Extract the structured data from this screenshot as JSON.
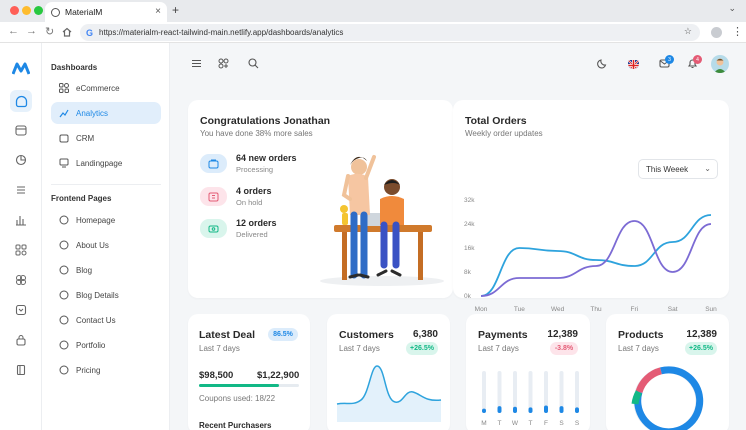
{
  "browser": {
    "tab_title": "MaterialM",
    "url": "https://materialm-react-tailwind-main.netlify.app/dashboards/analytics"
  },
  "sidebar": {
    "section_dashboards": "Dashboards",
    "dashboards": [
      {
        "label": "eCommerce",
        "icon": "grid-icon"
      },
      {
        "label": "Analytics",
        "icon": "chart-icon",
        "active": true
      },
      {
        "label": "CRM",
        "icon": "folder-icon"
      },
      {
        "label": "Landingpage",
        "icon": "screen-icon"
      }
    ],
    "section_frontend": "Frontend Pages",
    "frontend": [
      {
        "label": "Homepage",
        "icon": "circle-icon"
      },
      {
        "label": "About Us",
        "icon": "circle-icon"
      },
      {
        "label": "Blog",
        "icon": "circle-icon"
      },
      {
        "label": "Blog Details",
        "icon": "circle-icon"
      },
      {
        "label": "Contact Us",
        "icon": "circle-icon"
      },
      {
        "label": "Portfolio",
        "icon": "circle-icon"
      },
      {
        "label": "Pricing",
        "icon": "circle-icon"
      }
    ]
  },
  "header": {
    "notifications_mail": "3",
    "notifications_bell": "4",
    "language": "english-flag-icon"
  },
  "welcome": {
    "title": "Congratulations Jonathan",
    "subtitle": "You have done 38% more sales",
    "stats": [
      {
        "value": "64 new orders",
        "label": "Processing",
        "icon": "cart-icon",
        "color": "#1e88e5"
      },
      {
        "value": "4 orders",
        "label": "On hold",
        "icon": "pause-icon",
        "color": "#e45b75"
      },
      {
        "value": "12 orders",
        "label": "Delivered",
        "icon": "truck-icon",
        "color": "#12b886"
      }
    ]
  },
  "total_orders": {
    "title": "Total Orders",
    "subtitle": "Weekly order updates",
    "filter": "This Weeek",
    "chart_data": {
      "type": "line",
      "categories": [
        "Mon",
        "Tue",
        "Wed",
        "Thu",
        "Fri",
        "Sat",
        "Sun"
      ],
      "y_ticks": [
        "0k",
        "8k",
        "16k",
        "24k",
        "32k"
      ],
      "ylim": [
        0,
        32
      ],
      "series": [
        {
          "values": [
            0,
            16,
            15,
            12,
            10,
            18,
            27
          ],
          "color": "#2ea3dd"
        },
        {
          "values": [
            0,
            6,
            6,
            10,
            25,
            8,
            24
          ],
          "color": "#7c6bd4"
        }
      ]
    }
  },
  "cards": {
    "deal": {
      "title": "Latest Deal",
      "badge": "86.5%",
      "period": "Last 7 days",
      "amount_current": "$98,500",
      "amount_target": "$1,22,900",
      "progress": 0.8,
      "coupons": "Coupons used: 18/22",
      "recent": "Recent Purchasers"
    },
    "customers": {
      "title": "Customers",
      "value": "6,380",
      "period": "Last 7 days",
      "change": "+26.5%"
    },
    "payments": {
      "title": "Payments",
      "value": "12,389",
      "period": "Last 7 days",
      "change": "-3.8%",
      "days": [
        "M",
        "T",
        "W",
        "T",
        "F",
        "S",
        "S"
      ],
      "bars": [
        0.35,
        0.55,
        0.5,
        0.45,
        0.6,
        0.55,
        0.45
      ]
    },
    "products": {
      "title": "Products",
      "value": "12,389",
      "period": "Last 7 days",
      "change": "+26.5%"
    }
  }
}
